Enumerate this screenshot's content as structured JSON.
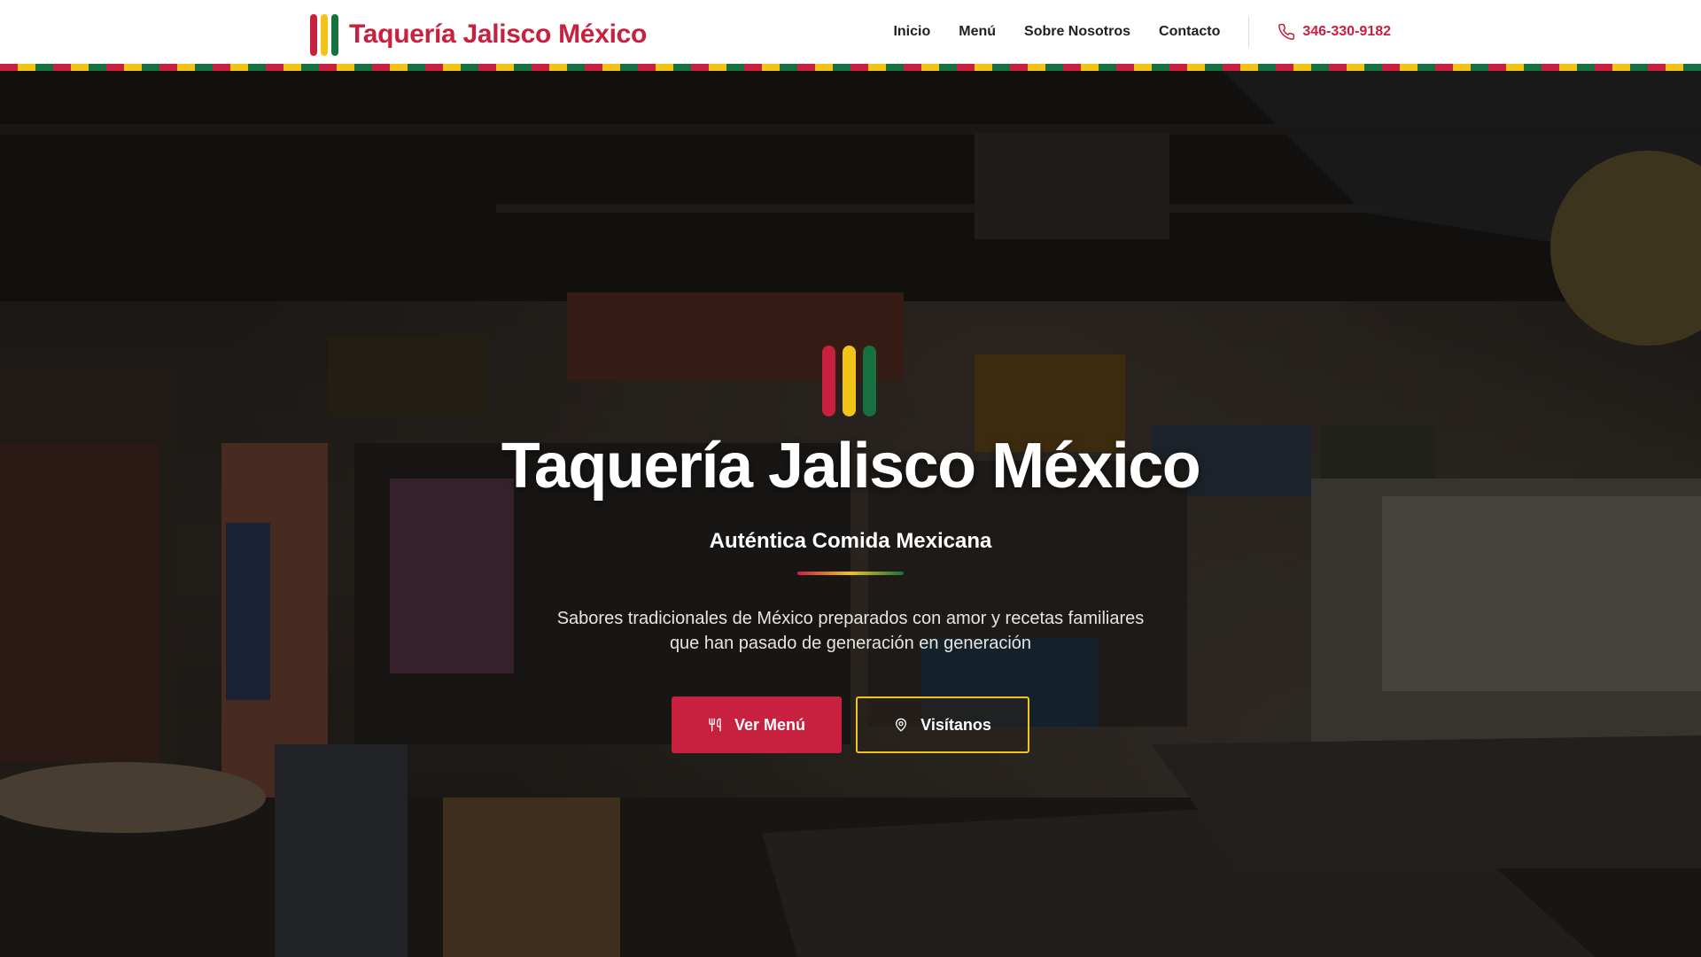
{
  "brand": {
    "name": "Taquería Jalisco México",
    "colors": {
      "red": "#c8203f",
      "yellow": "#f2c418",
      "green": "#16703f"
    }
  },
  "nav": {
    "links": [
      "Inicio",
      "Menú",
      "Sobre Nosotros",
      "Contacto"
    ],
    "phone": "346-330-9182",
    "phone_icon": "phone-icon"
  },
  "hero": {
    "title": "Taquería Jalisco México",
    "subtitle": "Auténtica Comida Mexicana",
    "description_lines": [
      "Sabores tradicionales de México preparados con amor y recetas familiares",
      "que han pasado de generación en generación"
    ],
    "primary_button": {
      "label": "Ver Menú",
      "icon": "utensils-icon"
    },
    "secondary_button": {
      "label": "Visítanos",
      "icon": "map-pin-icon"
    },
    "background": "restaurant-interior-photo"
  }
}
